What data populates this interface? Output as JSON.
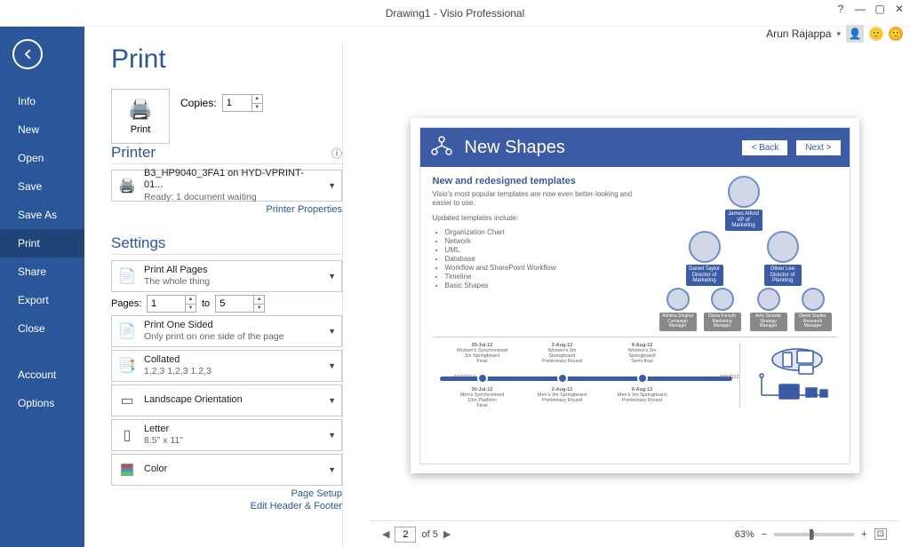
{
  "window": {
    "title": "Drawing1 - Visio Professional",
    "user": "Arun Rajappa"
  },
  "sidebar": {
    "items": [
      "Info",
      "New",
      "Open",
      "Save",
      "Save As",
      "Print",
      "Share",
      "Export",
      "Close"
    ],
    "active": "Print",
    "bottom": [
      "Account",
      "Options"
    ]
  },
  "page": {
    "header": "Print",
    "print_label": "Print",
    "copies_label": "Copies:",
    "copies_value": "1"
  },
  "printer": {
    "section": "Printer",
    "name": "B3_HP9040_3FA1 on HYD-VPRINT-01...",
    "status": "Ready: 1 document waiting",
    "link": "Printer Properties"
  },
  "settings": {
    "section": "Settings",
    "pages": {
      "label": "Pages:",
      "from": "1",
      "to_label": "to",
      "to": "5"
    },
    "opts": [
      {
        "l1": "Print All Pages",
        "l2": "The whole thing",
        "icon": "📄"
      },
      {
        "l1": "Print One Sided",
        "l2": "Only print on one side of the page",
        "icon": "📄"
      },
      {
        "l1": "Collated",
        "l2": "1,2,3    1,2,3    1,2,3",
        "icon": "📑"
      },
      {
        "l1": "Landscape Orientation",
        "l2": "",
        "icon": "▭"
      },
      {
        "l1": "Letter",
        "l2": "8.5\" x 11\"",
        "icon": "▯"
      },
      {
        "l1": "Color",
        "l2": "",
        "icon": "color"
      }
    ],
    "links": [
      "Page Setup",
      "Edit Header & Footer"
    ]
  },
  "preview": {
    "title": "New Shapes",
    "back": "<  Back",
    "next": "Next  >",
    "sub": "New and redesigned templates",
    "p1": "Visio's most popular templates are now even better-looking and easier to use.",
    "p2": "Updated templates include:",
    "bullets": [
      "Organization Chart",
      "Network",
      "UML",
      "Database",
      "Workflow and SharePoint Workflow",
      "Timeline",
      "Basic Shapes"
    ],
    "org": [
      {
        "name": "James Alford",
        "role": "VP of Marketing"
      },
      {
        "name": "Daniel Taylor",
        "role": "Director of Marketing"
      },
      {
        "name": "Oliver Lee",
        "role": "Director of Planning"
      },
      {
        "name": "Ashima Singhal",
        "role": "Campaign Manager"
      },
      {
        "name": "Diana Forsyth",
        "role": "Marketing Manager"
      },
      {
        "name": "Amy Strande",
        "role": "Strategy Manager"
      },
      {
        "name": "Derek Snyder",
        "role": "Research Manager"
      }
    ],
    "timeline": {
      "start": "7/27/2012",
      "end": "8/6/2012",
      "events": [
        {
          "d": "29-Jul-12",
          "t1": "Women's Synchronised 3m Springboard",
          "t2": "Final"
        },
        {
          "d": "30-Jul-12",
          "t1": "Men's Synchronised 10m Platform",
          "t2": "Final"
        },
        {
          "d": "2-Aug-12",
          "t1": "Women's 3m Springboard",
          "t2": "Preliminary Round"
        },
        {
          "d": "2-Aug-12",
          "t1": "Men's 3m Springboard",
          "t2": "Preliminary Round"
        },
        {
          "d": "9-Aug-12",
          "t1": "Women's 3m Springboard",
          "t2": "Semi-final"
        },
        {
          "d": "9-Aug-12",
          "t1": "Men's 3m Springboard",
          "t2": "Preliminary Round"
        }
      ]
    }
  },
  "footer": {
    "page_current": "2",
    "page_total": "of 5",
    "zoom": "63%"
  }
}
